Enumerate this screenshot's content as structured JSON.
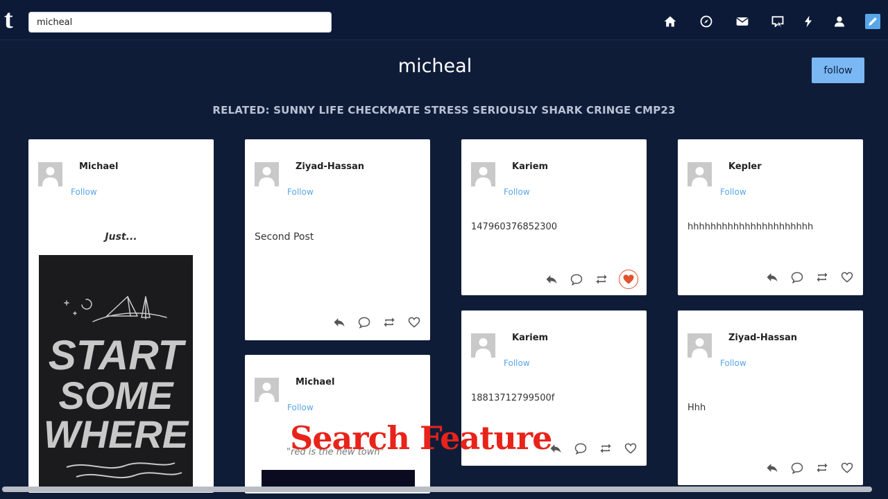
{
  "app": {
    "logo": "t"
  },
  "search": {
    "value": "micheal"
  },
  "nav": [
    "home-icon",
    "compass-icon",
    "mail-icon",
    "chat-icon",
    "lightning-icon",
    "account-icon",
    "edit-icon"
  ],
  "header": {
    "title": "micheal",
    "follow_label": "follow"
  },
  "related": "RELATED: SUNNY LIFE CHECKMATE STRESS SERIOUSLY SHARK CRINGE CMP23",
  "cards": [
    {
      "user": "Michael",
      "follow": "Follow",
      "text": "Just...",
      "poster": [
        "START",
        "SOME",
        "WHERE"
      ]
    },
    {
      "user": "Ziyad-Hassan",
      "follow": "Follow",
      "text": "Second Post"
    },
    {
      "user": "Michael",
      "follow": "Follow",
      "text": "\"red is the new town\""
    },
    {
      "user": "Kariem",
      "follow": "Follow",
      "text": "147960376852300",
      "liked": true
    },
    {
      "user": "Kariem",
      "follow": "Follow",
      "text": "18813712799500f"
    },
    {
      "user": "Kepler",
      "follow": "Follow",
      "text": "hhhhhhhhhhhhhhhhhhhhhh"
    },
    {
      "user": "Ziyad-Hassan",
      "follow": "Follow",
      "text": "Hhh"
    }
  ],
  "overlay_caption": "Search Feature",
  "colors": {
    "background": "#0f1c38",
    "accent": "#7ab8f4",
    "like": "#e0522f",
    "follow_link": "#58a6e8"
  }
}
